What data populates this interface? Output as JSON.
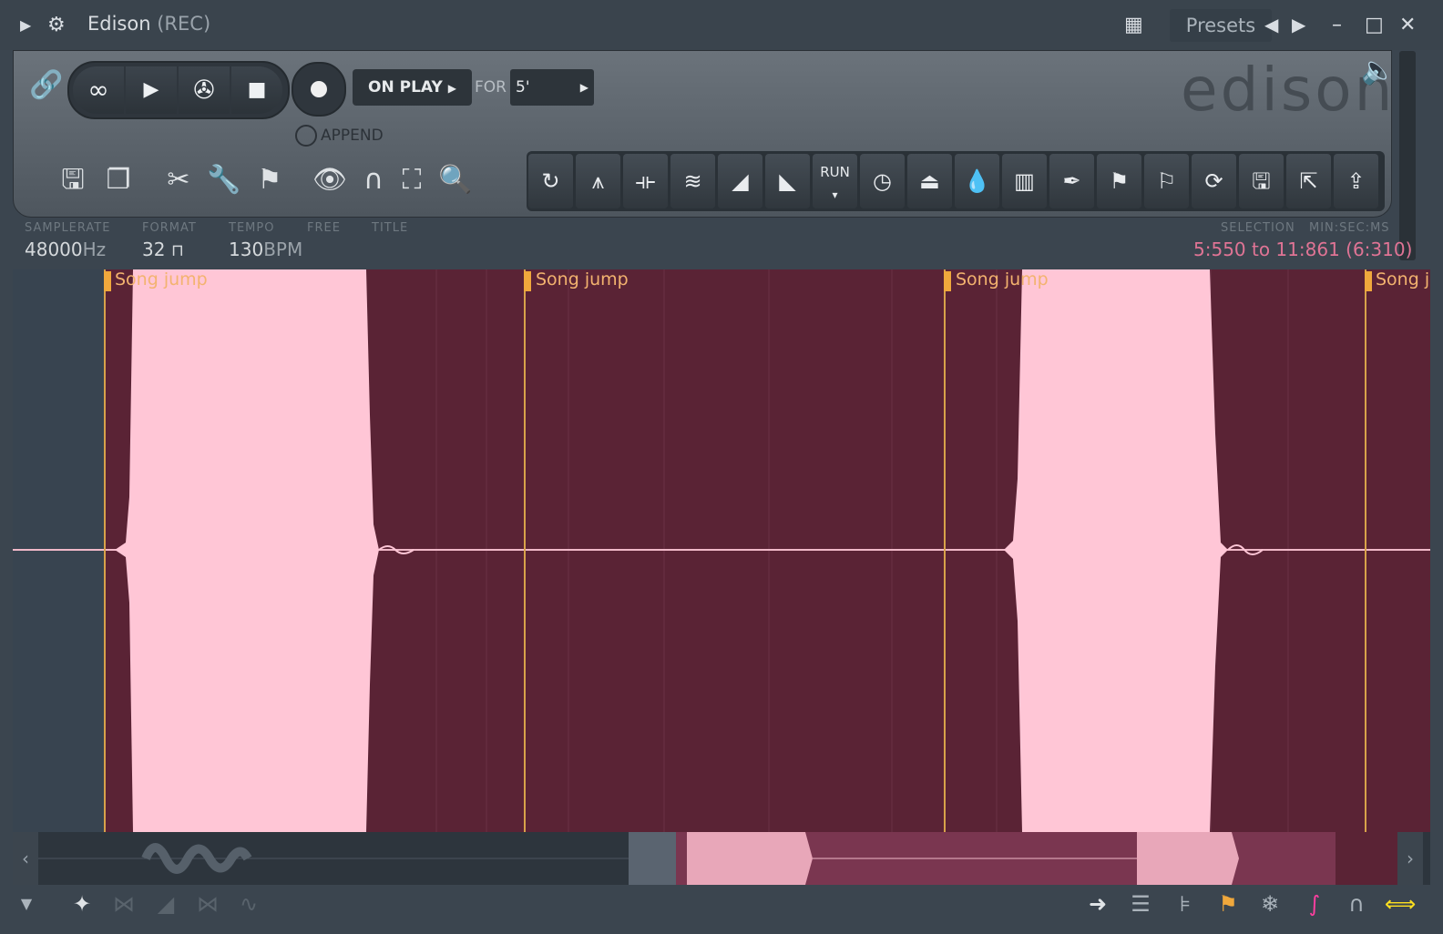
{
  "window": {
    "title": "Edison",
    "subtitle": "(REC)",
    "presets_label": "Presets"
  },
  "recorder": {
    "on_play_label": "ON PLAY",
    "for_label": "FOR",
    "for_value": "5'",
    "append_label": "APPEND",
    "logo": "edison",
    "run_label": "RUN"
  },
  "info": {
    "samplerate_label": "SAMPLERATE",
    "samplerate_value": "48000",
    "samplerate_unit": "Hz",
    "format_label": "FORMAT",
    "format_value": "32",
    "tempo_label": "TEMPO",
    "tempo_value": "130",
    "tempo_unit": "BPM",
    "free_label": "FREE",
    "title_label": "TITLE",
    "selection_label": "SELECTION",
    "time_format_label": "MIN:SEC:MS",
    "selection_value": "5:550 to 11:861 (6:310)"
  },
  "markers": [
    {
      "label": "Song jump"
    },
    {
      "label": "Song jump"
    },
    {
      "label": "Song jump"
    },
    {
      "label": "Song j"
    }
  ],
  "colors": {
    "selection_bg": "#5a2335",
    "waveform": "#ffc6d6",
    "marker": "#f0a83c",
    "selection_text": "#e07495"
  }
}
